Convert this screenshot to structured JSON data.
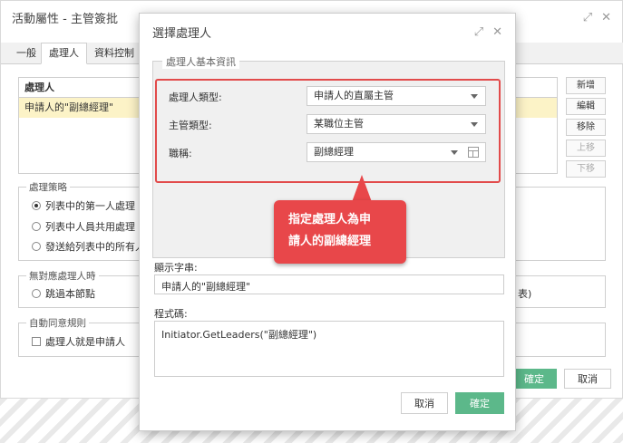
{
  "bg": {
    "title": "活動屬性 - 主管簽批",
    "tabs": [
      "一般",
      "處理人",
      "資料控制"
    ],
    "list_header": "處理人",
    "list_row": "申請人的\"副總經理\"",
    "side_buttons": [
      "新增",
      "編輯",
      "移除",
      "上移",
      "下移"
    ],
    "strategy": {
      "legend": "處理策略",
      "options": [
        "列表中的第一人處理",
        "列表中人員共用處理",
        "發送給列表中的所有人"
      ]
    },
    "no_handler": {
      "legend": "無對應處理人時",
      "option": "跳過本節點",
      "fragment": "表)"
    },
    "auto_agree": {
      "legend": "自動同意規則",
      "option": "處理人就是申請人"
    },
    "confirm": "確定",
    "cancel": "取消"
  },
  "modal": {
    "title": "選擇處理人",
    "group_legend": "處理人基本資訊",
    "fields": [
      {
        "label": "處理人類型:",
        "value": "申請人的直屬主管"
      },
      {
        "label": "主管類型:",
        "value": "某職位主管"
      },
      {
        "label": "職稱:",
        "value": "副總經理"
      }
    ],
    "display_label": "顯示字串:",
    "display_value": "申請人的\"副總經理\"",
    "code_label": "程式碼:",
    "code_value": "Initiator.GetLeaders(\"副總經理\")",
    "cancel": "取消",
    "confirm": "確定"
  },
  "callout": {
    "line1": "指定處理人為申",
    "line2": "請人的副總經理"
  },
  "colors": {
    "accent_green": "#5cb88a",
    "highlight_red": "#e24b4b",
    "row_highlight": "#fcf3c7"
  }
}
